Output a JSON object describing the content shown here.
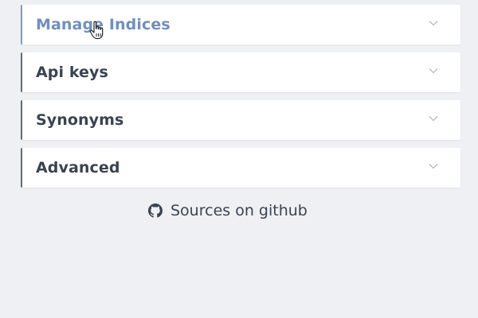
{
  "accordion": {
    "items": [
      {
        "label": "Manage Indices",
        "icon": "chevron-down-icon",
        "state": "hovered"
      },
      {
        "label": "Api keys",
        "icon": "chevron-down-icon",
        "state": "collapsed"
      },
      {
        "label": "Synonyms",
        "icon": "chevron-down-icon",
        "state": "collapsed"
      },
      {
        "label": "Advanced",
        "icon": "chevron-down-icon",
        "state": "collapsed"
      }
    ]
  },
  "footer": {
    "github_label": "Sources on github",
    "icon": "github-icon"
  },
  "colors": {
    "background": "#eef0f3",
    "panel_bg": "#ffffff",
    "text": "#3a4350",
    "active_text": "#6f8fbf",
    "border_accent": "#5a6c85"
  }
}
